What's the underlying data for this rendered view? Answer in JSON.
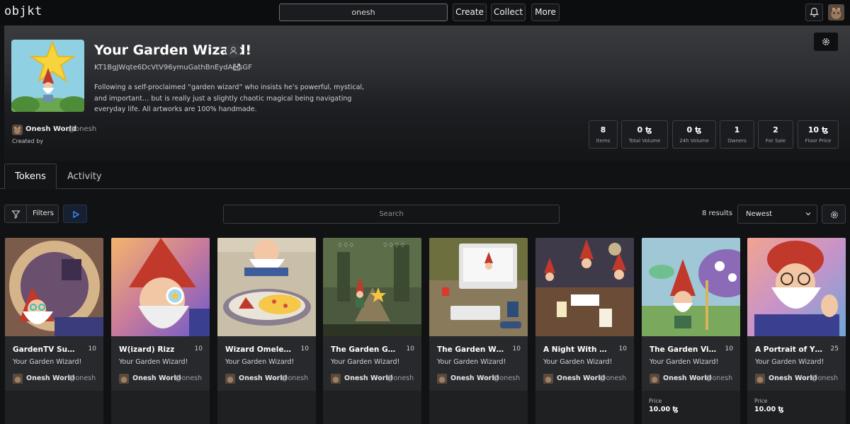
{
  "topbar": {
    "logo": "objkt",
    "search_value": "onesh",
    "nav": [
      "Create",
      "Collect",
      "More"
    ]
  },
  "collection": {
    "title": "Your Garden Wizard!",
    "contract": "KT1BgJWqte6DcVtV96ymuGathBnEydAeisGF",
    "description": "Following a self-proclaimed “garden wizard” who insists he’s powerful, mystical, and important… but is really just a slightly chaotic magical being navigating everyday life. All artworks are 100% handmade.",
    "creator": {
      "name": "Onesh World",
      "handle": "@onesh",
      "caption": "Created by"
    },
    "stats": [
      {
        "value": "8",
        "label": "Items"
      },
      {
        "value": "0 ꜩ",
        "label": "Total Volume"
      },
      {
        "value": "0 ꜩ",
        "label": "24h Volume"
      },
      {
        "value": "1",
        "label": "Owners"
      },
      {
        "value": "2",
        "label": "For Sale"
      },
      {
        "value": "10 ꜩ",
        "label": "Floor Price"
      }
    ]
  },
  "tabs": [
    "Tokens",
    "Activity"
  ],
  "toolbar": {
    "filters_label": "Filters",
    "search_placeholder": "Search",
    "results": "8 results",
    "sort": "Newest"
  },
  "cards": [
    {
      "title": "GardenTV Su…",
      "editions": "10",
      "collection": "Your Garden Wizard!",
      "artist": "Onesh World",
      "handle": "@onesh",
      "price_label": "",
      "price": ""
    },
    {
      "title": "W(izard) Rizz",
      "editions": "10",
      "collection": "Your Garden Wizard!",
      "artist": "Onesh World",
      "handle": "@onesh",
      "price_label": "",
      "price": ""
    },
    {
      "title": "Wizard Omele…",
      "editions": "10",
      "collection": "Your Garden Wizard!",
      "artist": "Onesh World",
      "handle": "@onesh",
      "price_label": "",
      "price": ""
    },
    {
      "title": "The Garden G…",
      "editions": "10",
      "collection": "Your Garden Wizard!",
      "artist": "Onesh World",
      "handle": "@onesh",
      "price_label": "",
      "price": ""
    },
    {
      "title": "The Garden W…",
      "editions": "10",
      "collection": "Your Garden Wizard!",
      "artist": "Onesh World",
      "handle": "@onesh",
      "price_label": "",
      "price": ""
    },
    {
      "title": "A Night With …",
      "editions": "10",
      "collection": "Your Garden Wizard!",
      "artist": "Onesh World",
      "handle": "@onesh",
      "price_label": "",
      "price": ""
    },
    {
      "title": "The Garden Vi…",
      "editions": "10",
      "collection": "Your Garden Wizard!",
      "artist": "Onesh World",
      "handle": "@onesh",
      "price_label": "Price",
      "price": "10.00 ꜩ"
    },
    {
      "title": "A Portrait of Y…",
      "editions": "25",
      "collection": "Your Garden Wizard!",
      "artist": "Onesh World",
      "handle": "@onesh",
      "price_label": "Price",
      "price": "10.00 ꜩ"
    }
  ],
  "colors": {
    "background": "#111214",
    "card": "#28292c",
    "accent": "#3b82f6"
  }
}
